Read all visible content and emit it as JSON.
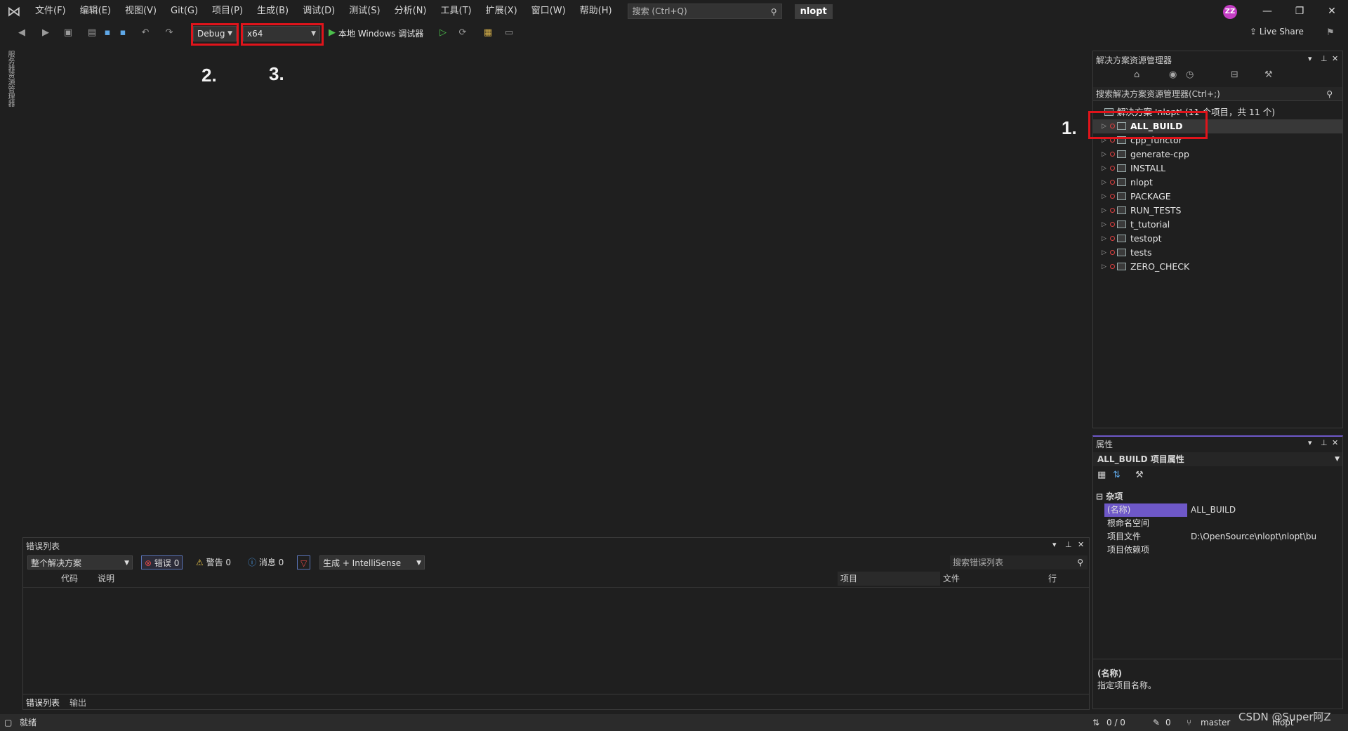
{
  "menu": {
    "items": [
      "文件(F)",
      "编辑(E)",
      "视图(V)",
      "Git(G)",
      "项目(P)",
      "生成(B)",
      "调试(D)",
      "测试(S)",
      "分析(N)",
      "工具(T)",
      "扩展(X)",
      "窗口(W)",
      "帮助(H)"
    ],
    "search_placeholder": "搜索 (Ctrl+Q)",
    "solution_name": "nlopt",
    "user_initials": "ZZ"
  },
  "toolbar": {
    "config": "Debug",
    "platform": "x64",
    "run_target": "本地 Windows 调试器",
    "live_share": "Live Share"
  },
  "annotations": {
    "one": "1.",
    "two": "2.",
    "three": "3."
  },
  "left_vtab": "服务器资源管理器",
  "solution_explorer": {
    "title": "解决方案资源管理器",
    "search": "搜索解决方案资源管理器(Ctrl+;)",
    "root": "解决方案 'nlopt' (11 个项目，共 11 个)",
    "projects": [
      "ALL_BUILD",
      "cpp_functor",
      "generate-cpp",
      "INSTALL",
      "nlopt",
      "PACKAGE",
      "RUN_TESTS",
      "t_tutorial",
      "testopt",
      "tests",
      "ZERO_CHECK"
    ]
  },
  "properties": {
    "title": "属性",
    "object": "ALL_BUILD 项目属性",
    "category": "杂项",
    "rows": [
      {
        "key": "(名称)",
        "val": "ALL_BUILD"
      },
      {
        "key": "根命名空间",
        "val": ""
      },
      {
        "key": "项目文件",
        "val": "D:\\OpenSource\\nlopt\\nlopt\\bu"
      },
      {
        "key": "项目依赖项",
        "val": ""
      }
    ],
    "desc_title": "(名称)",
    "desc_text": "指定项目名称。"
  },
  "error_list": {
    "title": "错误列表",
    "scope": "整个解决方案",
    "errors": "错误 0",
    "warnings": "警告 0",
    "messages": "消息 0",
    "source": "生成 + IntelliSense",
    "search": "搜索错误列表",
    "columns": {
      "code": "代码",
      "desc": "说明",
      "project": "项目",
      "file": "文件",
      "line": "行"
    },
    "tabs": [
      "错误列表",
      "输出"
    ]
  },
  "status": {
    "ready": "就绪",
    "lines": "0 / 0",
    "edits": "0",
    "branch": "master",
    "repo": "nlopt",
    "watermark": "CSDN @Super阿Z"
  }
}
